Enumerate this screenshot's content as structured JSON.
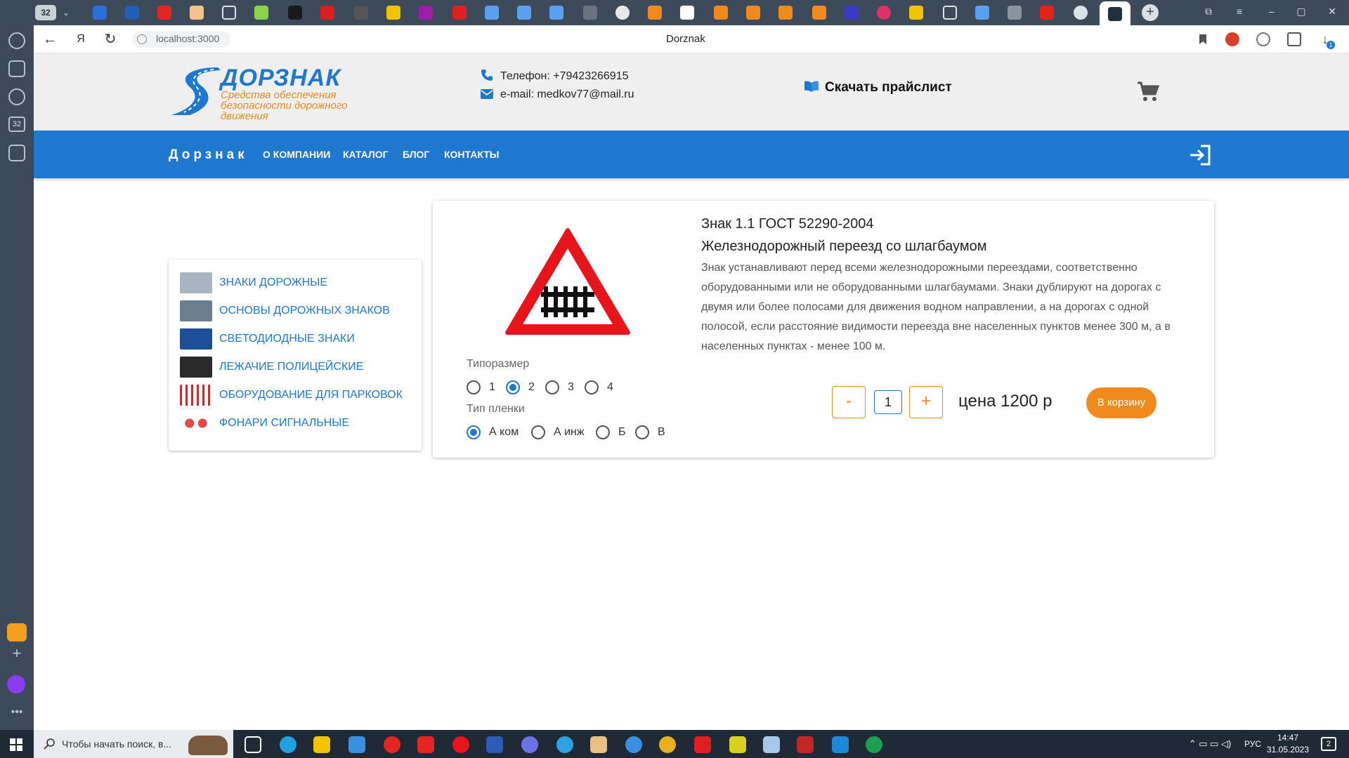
{
  "browser": {
    "tab_count": "32",
    "address": "localhost:3000",
    "page_title": "Dorznak",
    "download_badge": "1"
  },
  "header": {
    "logo_title": "ДОРЗНАК",
    "logo_subtitle": "Средства обеспечения безопасности дорожного движения",
    "phone": "Телефон: +79423266915",
    "email": "e-mail: medkov77@mail.ru",
    "pricelist": "Скачать прайслист"
  },
  "nav": {
    "brand": "Дорзнак",
    "links": [
      "О КОМПАНИИ",
      "КАТАЛОГ",
      "БЛОГ",
      "КОНТАКТЫ"
    ]
  },
  "categories": [
    {
      "label": "ЗНАКИ ДОРОЖНЫЕ",
      "thumb_color": "#a8b4c0"
    },
    {
      "label": "ОСНОВЫ ДОРОЖНЫХ ЗНАКОВ",
      "thumb_color": "#6c7f8e"
    },
    {
      "label": "СВЕТОДИОДНЫЕ ЗНАКИ",
      "thumb_color": "#1c4f98"
    },
    {
      "label": "ЛЕЖАЧИЕ ПОЛИЦЕЙСКИЕ",
      "thumb_color": "#2a2a2a"
    },
    {
      "label": "ОБОРУДОВАНИЕ ДЛЯ ПАРКОВОК",
      "thumb_color": "#d9a0a0"
    },
    {
      "label": "ФОНАРИ СИГНАЛЬНЫЕ",
      "thumb_color": "#e24a4a"
    }
  ],
  "product": {
    "code": "Знак 1.1 ГОСТ 52290-2004",
    "name": "Железнодорожный переезд со шлагбаумом",
    "description": "Знак устанавливают перед всеми железнодорожными переездами, соответственно оборудованными или не оборудованными шлагбаумами. Знаки дублируют на дорогах с двумя или более полосами для движения водном направлении, а на дорогах с одной полосой, если расстояние видимости переезда вне населенных пунктов менее 300 м, а в населенных пунктах - менее 100 м.",
    "size_title": "Типоразмер",
    "size_options": [
      "1",
      "2",
      "3",
      "4"
    ],
    "size_selected": "2",
    "film_title": "Тип пленки",
    "film_options": [
      "А ком",
      "А инж",
      "Б",
      "В"
    ],
    "film_selected": "А ком",
    "minus_label": "-",
    "plus_label": "+",
    "quantity": "1",
    "price": "цена 1200 р",
    "buy_label": "В корзину"
  },
  "taskbar": {
    "search_placeholder": "Чтобы начать поиск, в...",
    "lang": "РУС",
    "time": "14:47",
    "date": "31.05.2023",
    "notifications": "2"
  },
  "colors": {
    "brand_blue": "#1e78d0",
    "accent_orange": "#f08a1c",
    "sign_red": "#e8141c"
  }
}
